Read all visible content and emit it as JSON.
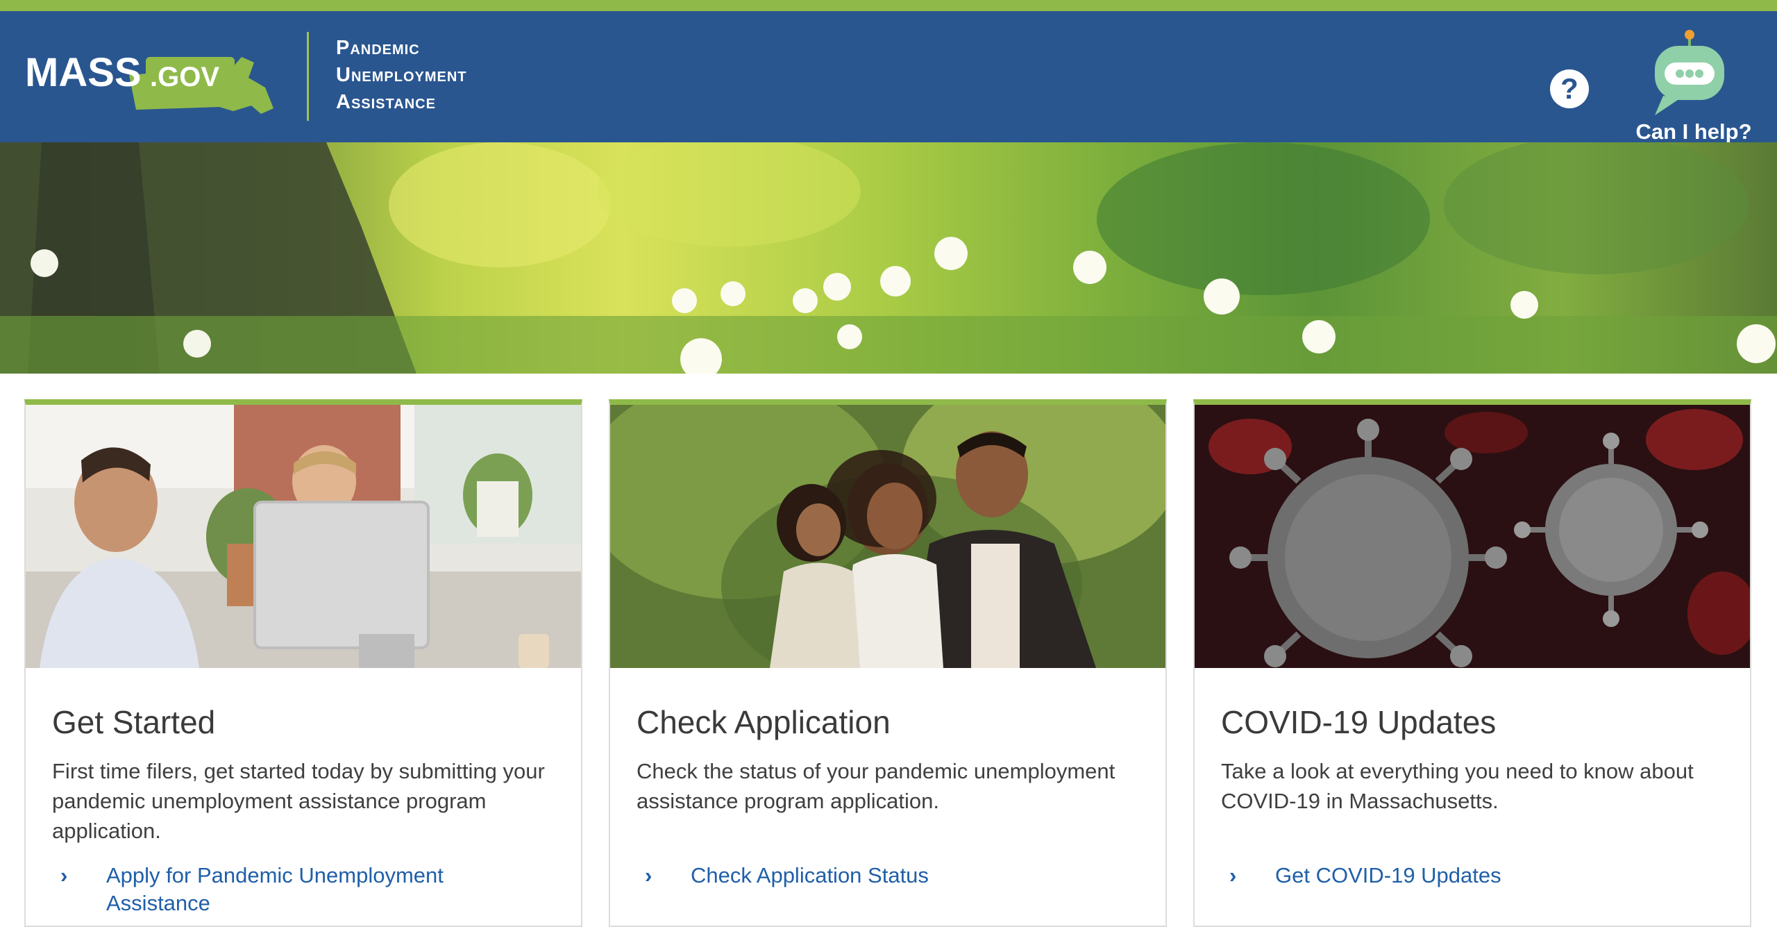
{
  "colors": {
    "accent_green": "#8fba4a",
    "header_blue": "#2a5690",
    "link_blue": "#1f5fa8"
  },
  "header": {
    "logo_text": "MASS.GOV",
    "program_title_lines": [
      "Pandemic",
      "Unemployment",
      "Assistance"
    ],
    "help_icon": "question-circle-icon",
    "chat_icon": "robot-chat-icon",
    "chat_label": "Can I help?"
  },
  "cards": [
    {
      "title": "Get Started",
      "description": "First time filers, get started today by submitting your pandemic unemployment assistance program application.",
      "link_label": "Apply for Pandemic Unemployment Assistance",
      "link_icon": "chevron-right-icon"
    },
    {
      "title": "Check Application",
      "description": "Check the status of your pandemic unemployment assistance program application.",
      "link_label": "Check Application Status",
      "link_icon": "chevron-right-icon"
    },
    {
      "title": "COVID-19 Updates",
      "description": "Take a look at everything you need to know about COVID-19 in Massachusetts.",
      "link_label": "Get COVID-19 Updates",
      "link_icon": "chevron-right-icon"
    }
  ]
}
